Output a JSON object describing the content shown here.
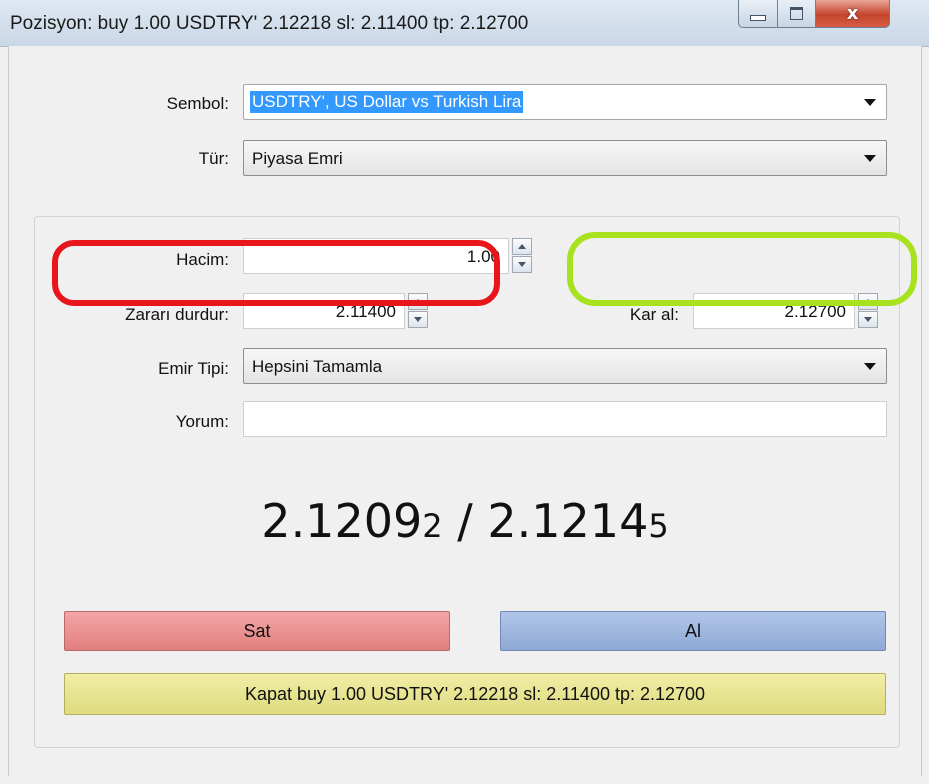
{
  "window": {
    "title": "Pozisyon: buy 1.00 USDTRY' 2.12218 sl: 2.11400 tp: 2.12700",
    "close_glyph": "x"
  },
  "form": {
    "symbol_label": "Sembol:",
    "symbol_value": "USDTRY', US Dollar vs Turkish Lira",
    "type_label": "Tür:",
    "type_value": "Piyasa Emri",
    "volume_label": "Hacim:",
    "volume_value": "1.00",
    "stop_loss_label": "Zararı durdur:",
    "stop_loss_value": "2.11400",
    "take_profit_label": "Kar al:",
    "take_profit_value": "2.12700",
    "fill_type_label": "Emir Tipi:",
    "fill_type_value": "Hepsini Tamamla",
    "comment_label": "Yorum:",
    "comment_value": ""
  },
  "quote": {
    "bid_main": "2.1209",
    "bid_last": "2",
    "separator": " / ",
    "ask_main": "2.1214",
    "ask_last": "5"
  },
  "buttons": {
    "sell": "Sat",
    "buy": "Al",
    "close": "Kapat buy 1.00 USDTRY' 2.12218 sl: 2.11400 tp: 2.12700"
  },
  "colors": {
    "sell": "#e27f7f",
    "buy": "#8fa9d6",
    "close": "#dedb80",
    "highlight_stop_loss": "#e8151b",
    "highlight_take_profit": "#a8e21e"
  }
}
